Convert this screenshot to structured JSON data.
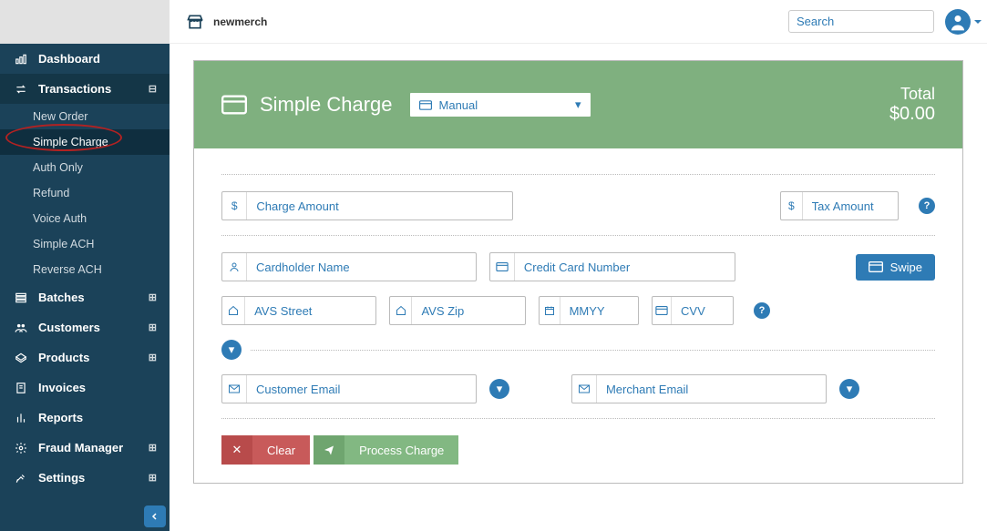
{
  "brand": {
    "name": "newmerch"
  },
  "search": {
    "placeholder": "Search"
  },
  "sidebar": {
    "dashboard": "Dashboard",
    "transactions": "Transactions",
    "subs": {
      "new_order": "New Order",
      "simple_charge": "Simple Charge",
      "auth_only": "Auth Only",
      "refund": "Refund",
      "voice_auth": "Voice Auth",
      "simple_ach": "Simple ACH",
      "reverse_ach": "Reverse ACH"
    },
    "batches": "Batches",
    "customers": "Customers",
    "products": "Products",
    "invoices": "Invoices",
    "reports": "Reports",
    "fraud": "Fraud Manager",
    "settings": "Settings"
  },
  "panel": {
    "title": "Simple Charge",
    "mode": "Manual",
    "total_label": "Total",
    "total_value": "$0.00"
  },
  "fields": {
    "charge_amount": "Charge Amount",
    "tax_amount": "Tax Amount",
    "cardholder": "Cardholder Name",
    "card_number": "Credit Card Number",
    "swipe": "Swipe",
    "avs_street": "AVS Street",
    "avs_zip": "AVS Zip",
    "mmyy": "MMYY",
    "cvv": "CVV",
    "customer_email": "Customer Email",
    "merchant_email": "Merchant Email"
  },
  "actions": {
    "clear": "Clear",
    "process": "Process Charge"
  }
}
